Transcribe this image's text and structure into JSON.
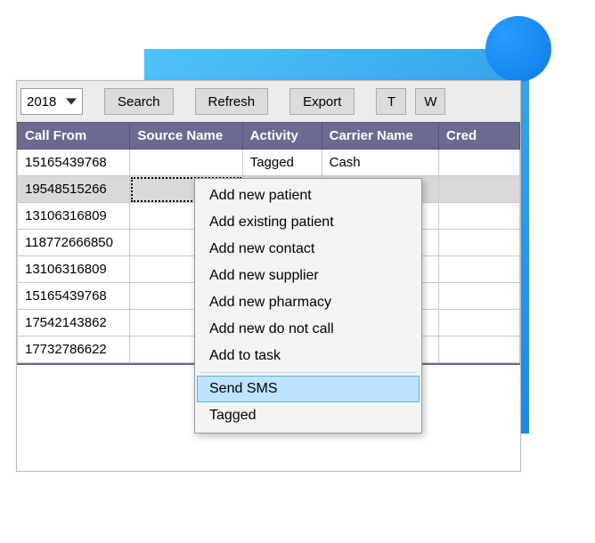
{
  "decor": {
    "shape": "square+circle"
  },
  "toolbar": {
    "year": "2018",
    "search": "Search",
    "refresh": "Refresh",
    "export": "Export",
    "t": "T",
    "w": "W"
  },
  "columns": {
    "call_from": "Call From",
    "source_name": "Source Name",
    "activity": "Activity",
    "carrier_name": "Carrier Name",
    "cred": "Cred"
  },
  "rows": [
    {
      "call_from": "15165439768",
      "source_name": "",
      "activity": "Tagged",
      "carrier_name": "Cash",
      "cred": ""
    },
    {
      "call_from": "19548515266",
      "source_name": "",
      "activity": "",
      "carrier_name": "",
      "cred": ""
    },
    {
      "call_from": "13106316809",
      "source_name": "",
      "activity": "",
      "carrier_name": "",
      "cred": ""
    },
    {
      "call_from": "118772666850",
      "source_name": "",
      "activity": "",
      "carrier_name": "",
      "cred": ""
    },
    {
      "call_from": "13106316809",
      "source_name": "",
      "activity": "",
      "carrier_name": "",
      "cred": ""
    },
    {
      "call_from": "15165439768",
      "source_name": "",
      "activity": "",
      "carrier_name": "",
      "cred": ""
    },
    {
      "call_from": "17542143862",
      "source_name": "",
      "activity": "",
      "carrier_name": "",
      "cred": ""
    },
    {
      "call_from": "17732786622",
      "source_name": "",
      "activity": "",
      "carrier_name": "",
      "cred": ""
    }
  ],
  "selected_row_index": 1,
  "context_menu": {
    "items": [
      "Add new patient",
      "Add existing patient",
      "Add new contact",
      "Add new supplier",
      "Add new pharmacy",
      "Add new do not call",
      "Add to task",
      "Send SMS",
      "Tagged"
    ],
    "highlight_index": 7,
    "separator_after_index": 6
  }
}
